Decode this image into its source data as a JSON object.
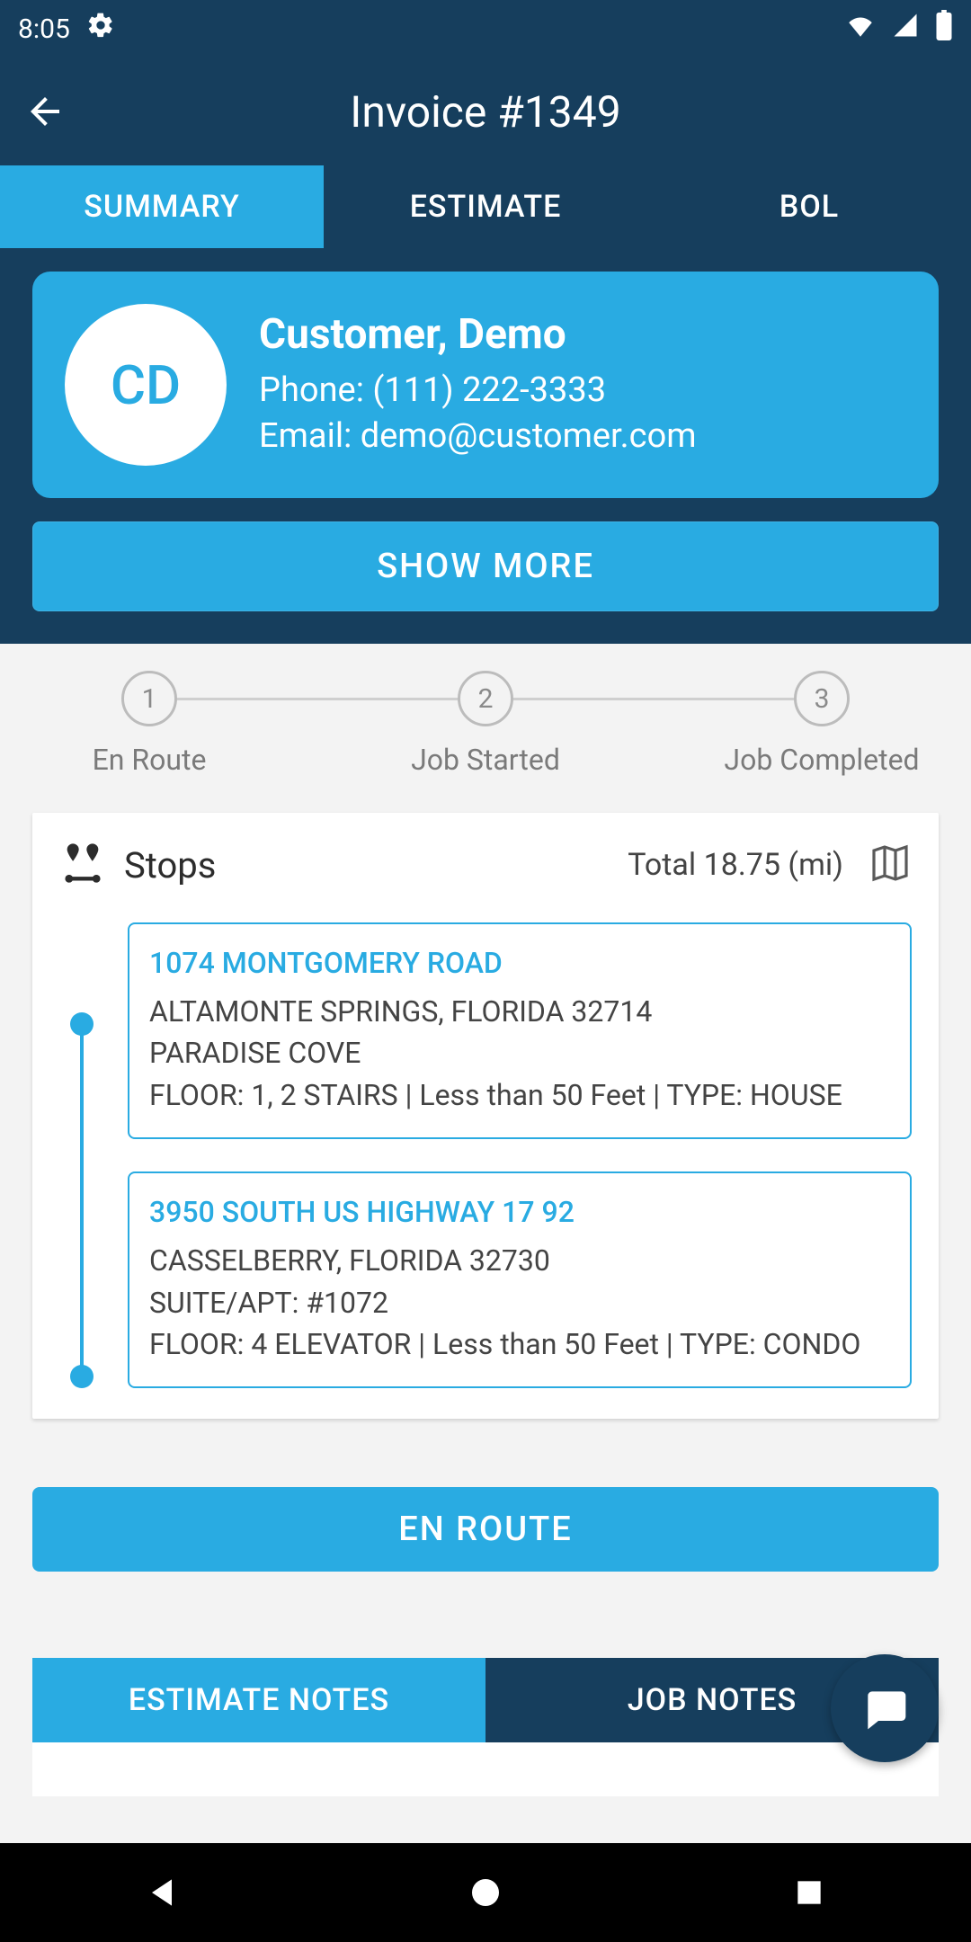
{
  "status_bar": {
    "time": "8:05"
  },
  "header": {
    "title": "Invoice #1349"
  },
  "tabs": [
    {
      "label": "SUMMARY",
      "active": true
    },
    {
      "label": "ESTIMATE",
      "active": false
    },
    {
      "label": "BOL",
      "active": false
    }
  ],
  "customer": {
    "initials": "CD",
    "name": "Customer, Demo",
    "phone_label": "Phone: (111) 222-3333",
    "email_label": "Email: demo@customer.com"
  },
  "show_more_label": "SHOW MORE",
  "stepper": [
    {
      "num": "1",
      "label": "En Route"
    },
    {
      "num": "2",
      "label": "Job Started"
    },
    {
      "num": "3",
      "label": "Job Completed"
    }
  ],
  "stops": {
    "title": "Stops",
    "total": "Total 18.75 (mi)",
    "list": [
      {
        "address": "1074 MONTGOMERY ROAD",
        "city": "ALTAMONTE SPRINGS, FLORIDA 32714",
        "extra": "PARADISE COVE",
        "details": "FLOOR: 1, 2 STAIRS | Less than 50 Feet | TYPE: HOUSE"
      },
      {
        "address": "3950 SOUTH US HIGHWAY 17 92",
        "city": "CASSELBERRY, FLORIDA 32730",
        "extra": "SUITE/APT: #1072",
        "details": "FLOOR: 4 ELEVATOR | Less than 50 Feet | TYPE: CONDO"
      }
    ]
  },
  "en_route_label": "EN ROUTE",
  "notes_tabs": {
    "estimate": "ESTIMATE NOTES",
    "job": "JOB NOTES"
  }
}
